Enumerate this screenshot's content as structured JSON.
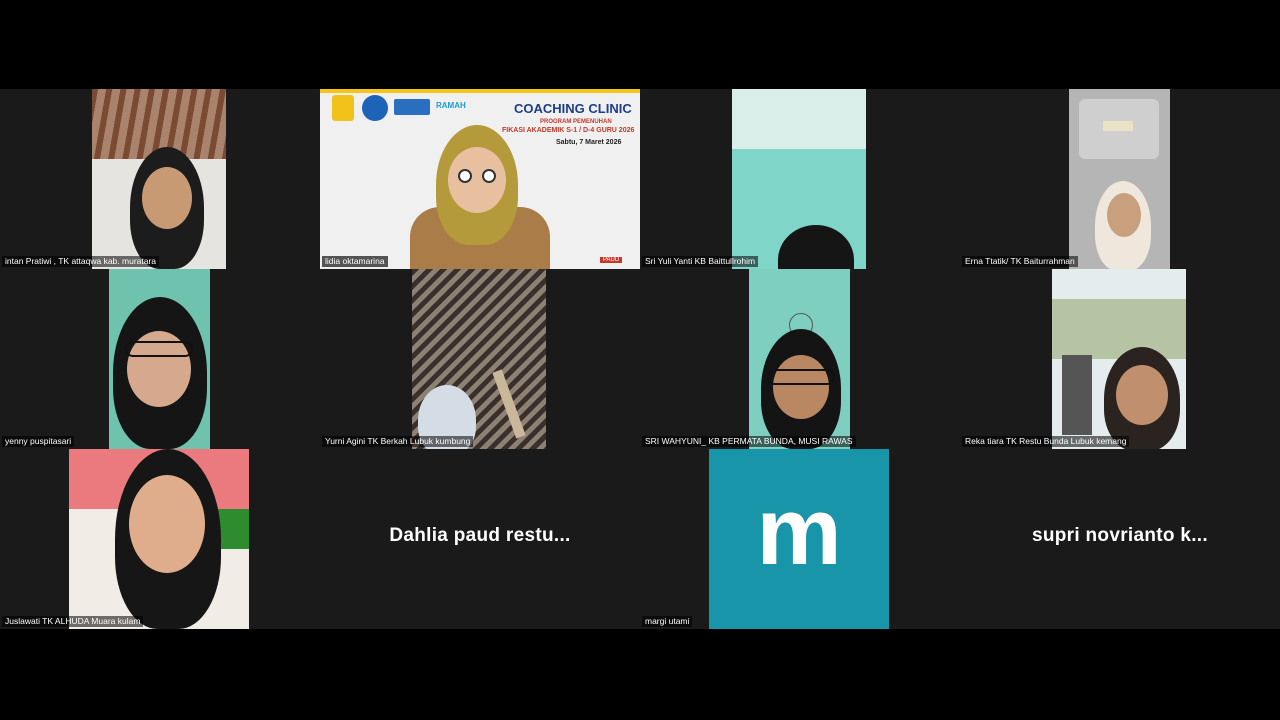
{
  "participants": [
    {
      "name": "intan Pratiwi , TK attaqwa kab. muratara"
    },
    {
      "name": "lidia oktamarina"
    },
    {
      "name": "Sri Yuli Yanti KB Baittullrohim"
    },
    {
      "name": "Erna Ttatik/ TK Baiturrahman"
    },
    {
      "name": "yenny puspitasari"
    },
    {
      "name": "Yurni Agini TK Berkah Lubuk kumbung"
    },
    {
      "name": "SRI WAHYUNI_ KB PERMATA BUNDA, MUSI RAWAS"
    },
    {
      "name": "Reka tiara TK Restu Bunda Lubuk kemang"
    },
    {
      "name": "Juslawati TK ALHUDA Muara kulam"
    },
    {
      "name": "Dahlia paud restu..."
    },
    {
      "name": "margi utami",
      "avatar_letter": "m"
    },
    {
      "name": "supri novrianto k..."
    }
  ],
  "banner": {
    "title": "COACHING CLINIC",
    "line1": "PROGRAM PEMENUHAN",
    "line2": "FIKASI AKADEMIK S-1 / D-4 GURU 2026",
    "date": "Sabtu, 7 Maret 2026",
    "tag": "PAUD",
    "logo_text": "RAMAH"
  },
  "colors": {
    "avatar_bg": "#1895a8",
    "stage_bg": "#1a1a1a"
  }
}
